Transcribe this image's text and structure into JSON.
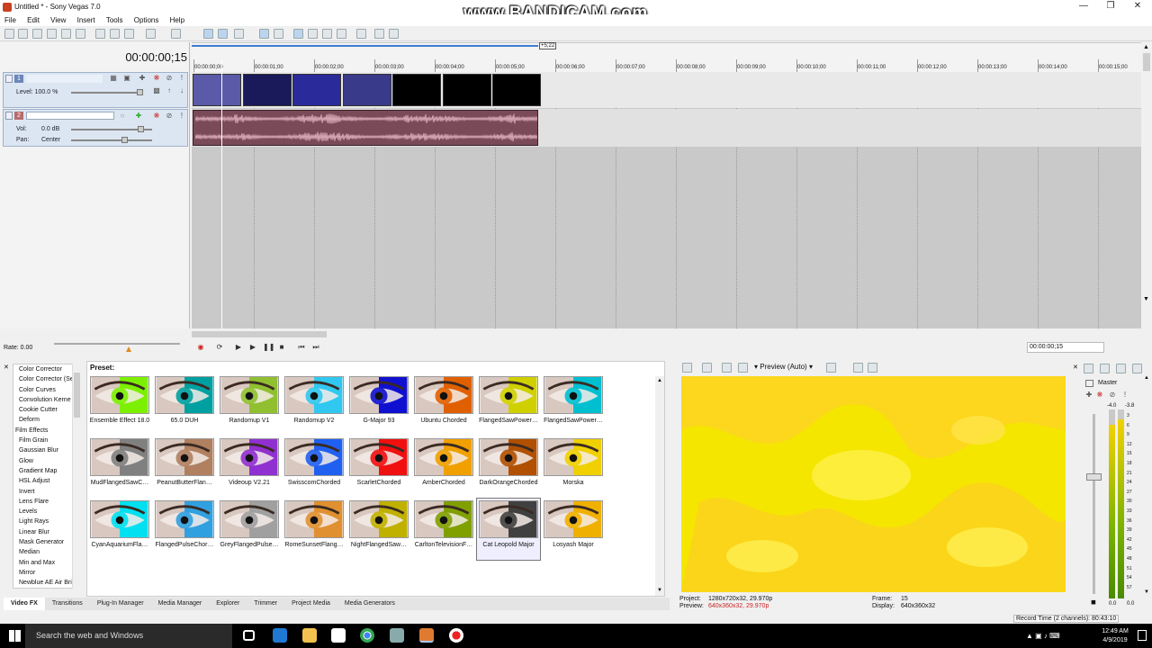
{
  "window": {
    "title": "Untitled * - Sony Vegas 7.0"
  },
  "watermark": "www.BANDICAM.com",
  "menus": [
    "File",
    "Edit",
    "View",
    "Insert",
    "Tools",
    "Options",
    "Help"
  ],
  "timecode": "00:00:00;15",
  "tracks": {
    "video": {
      "number": "1",
      "level_label": "Level: 100.0 %",
      "level": 1.0
    },
    "audio": {
      "number": "2",
      "vol_label": "Vol:",
      "vol_value": "0.0 dB",
      "pan_label": "Pan:",
      "pan_value": "Center"
    }
  },
  "ruler": {
    "length_badge": "+5;22",
    "ticks": [
      "00:00:00;00",
      "00:00:01;00",
      "00:00:02;00",
      "00:00:03;00",
      "00:00:04;00",
      "00:00:05;00",
      "00:00:06;00",
      "00:00:07;00",
      "00:00:08;00",
      "00:00:09;00",
      "00:00:10;00",
      "00:00:11;00",
      "00:00:12;00",
      "00:00:13;00",
      "00:00:14;00",
      "00:00:15;00"
    ]
  },
  "clips": [
    {
      "color": "#5a5aa8"
    },
    {
      "color": "#1a1a5a"
    },
    {
      "color": "#2a2a9a"
    },
    {
      "color": "#3a3a8a"
    },
    {
      "color": "#000000"
    },
    {
      "color": "#000000"
    },
    {
      "color": "#000000"
    }
  ],
  "transport": {
    "rate": "Rate: 0.00",
    "timecode": "00:00:00;15"
  },
  "fx_list": [
    "Color Corrector",
    "Color Corrector (Se",
    "Color Curves",
    "Convolution Kerne",
    "Cookie Cutter",
    "Deform",
    "Film Effects",
    "Film Grain",
    "Gaussian Blur",
    "Glow",
    "Gradient Map",
    "HSL Adjust",
    "Invert",
    "Lens Flare",
    "Levels",
    "Light Rays",
    "Linear Blur",
    "Mask Generator",
    "Median",
    "Min and Max",
    "Mirror",
    "Newblue AE Air Bri"
  ],
  "preset_label": "Preset:",
  "presets": [
    {
      "label": "Ensemble Effect 18.0",
      "tint": "#7cf000"
    },
    {
      "label": "65.0 DUH",
      "tint": "#00a0a0"
    },
    {
      "label": "Randomup V1",
      "tint": "#90c030"
    },
    {
      "label": "Randomup V2",
      "tint": "#30c8f0"
    },
    {
      "label": "G-Major 93",
      "tint": "#1010d0"
    },
    {
      "label": "Ubuntu Chorded",
      "tint": "#e06000"
    },
    {
      "label": "FlangedSawPower…",
      "tint": "#d0d000"
    },
    {
      "label": "FlangedSawPower…",
      "tint": "#00c0d0"
    },
    {
      "label": "MudFlangedSawC…",
      "tint": "#808080"
    },
    {
      "label": "PeanutButterFlan…",
      "tint": "#b08060"
    },
    {
      "label": "Videoup V2.21",
      "tint": "#9030d0"
    },
    {
      "label": "SwisscomChorded",
      "tint": "#2060f0"
    },
    {
      "label": "ScarletChorded",
      "tint": "#f01010"
    },
    {
      "label": "AmberChorded",
      "tint": "#f0a000"
    },
    {
      "label": "DarkOrangeChorded",
      "tint": "#b05000"
    },
    {
      "label": "Morska",
      "tint": "#f0d000"
    },
    {
      "label": "CyanAquariumFla…",
      "tint": "#00e0f0"
    },
    {
      "label": "FlangedPulseChor…",
      "tint": "#30a0e0"
    },
    {
      "label": "GreyFlangedPulse…",
      "tint": "#a0a0a0"
    },
    {
      "label": "RomeSunsetFlang…",
      "tint": "#e09030"
    },
    {
      "label": "NightFlangedSaw…",
      "tint": "#c0b000"
    },
    {
      "label": "CarltonTelevisionF…",
      "tint": "#80a000"
    },
    {
      "label": "Cat Leopold Major",
      "tint": "#404040",
      "selected": true
    },
    {
      "label": "Losyash Major",
      "tint": "#f0b000"
    }
  ],
  "tabs": [
    "Video FX",
    "Transitions",
    "Plug-In Manager",
    "Media Manager",
    "Explorer",
    "Trimmer",
    "Project Media",
    "Media Generators"
  ],
  "preview": {
    "mode": "Preview (Auto)",
    "project_label": "Project:",
    "project_value": "1280x720x32, 29.970p",
    "preview_label": "Preview:",
    "preview_value": "640x360x32, 29.970p",
    "frame_label": "Frame:",
    "frame_value": "15",
    "display_label": "Display:",
    "display_value": "640x360x32"
  },
  "master": {
    "label": "Master",
    "peak_left": "-4.0",
    "peak_right": "-3.8",
    "scale": [
      "3",
      "6",
      "9",
      "12",
      "15",
      "18",
      "21",
      "24",
      "27",
      "30",
      "33",
      "36",
      "39",
      "42",
      "45",
      "48",
      "51",
      "54",
      "57"
    ],
    "bottom_left": "0.0",
    "bottom_right": "0.0",
    "level_left": 0.92,
    "level_right": 0.95
  },
  "status": {
    "record_time": "Record Time (2 channels): 80:43:10"
  },
  "taskbar": {
    "search_placeholder": "Search the web and Windows",
    "time": "12:49 AM",
    "date": "4/9/2019"
  },
  "colors": {
    "accent": "#3c7bd0",
    "preview_yellow": "#f5e100",
    "audio_clip": "#7a4a58"
  }
}
